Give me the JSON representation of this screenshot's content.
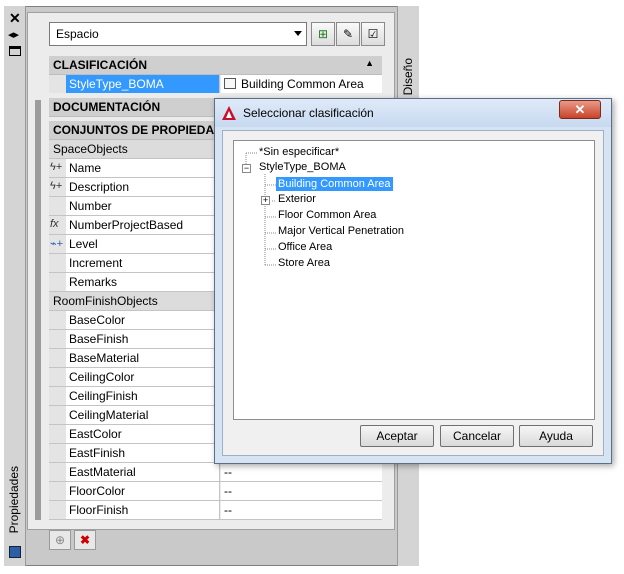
{
  "palette": {
    "left_icons": [
      "close-icon",
      "auto-hide-icon",
      "properties-menu-icon"
    ],
    "vertical_tab_left": "Propiedades",
    "vertical_tab_right": "Diseño",
    "dropdown_value": "Espacio",
    "toolbar_buttons": [
      "select-objects-icon",
      "quick-select-icon",
      "toggle-pickadd-icon"
    ],
    "sections": {
      "clasificacion": "CLASIFICACIÓN",
      "documentacion": "DOCUMENTACIÓN",
      "conjuntos": "CONJUNTOS DE PROPIEDADES"
    },
    "classification_row": {
      "name": "StyleType_BOMA",
      "value": "Building Common Area"
    },
    "groups": {
      "space": "SpaceObjects",
      "room": "RoomFinishObjects"
    },
    "space_rows": [
      {
        "name": "Name",
        "icon": "auto-property-icon"
      },
      {
        "name": "Description",
        "icon": "auto-property-icon"
      },
      {
        "name": "Number",
        "icon": ""
      },
      {
        "name": "NumberProjectBased",
        "icon": "formula-icon"
      },
      {
        "name": "Level",
        "icon": "level-icon"
      },
      {
        "name": "Increment",
        "icon": ""
      },
      {
        "name": "Remarks",
        "icon": ""
      }
    ],
    "room_rows": [
      {
        "name": "BaseColor",
        "value": ""
      },
      {
        "name": "BaseFinish",
        "value": ""
      },
      {
        "name": "BaseMaterial",
        "value": ""
      },
      {
        "name": "CeilingColor",
        "value": ""
      },
      {
        "name": "CeilingFinish",
        "value": ""
      },
      {
        "name": "CeilingMaterial",
        "value": ""
      },
      {
        "name": "EastColor",
        "value": ""
      },
      {
        "name": "EastFinish",
        "value": ""
      },
      {
        "name": "EastMaterial",
        "value": "--"
      },
      {
        "name": "FloorColor",
        "value": "--"
      },
      {
        "name": "FloorFinish",
        "value": "--"
      }
    ],
    "bottom_buttons": [
      "add-property-set-icon",
      "remove-property-set-icon"
    ]
  },
  "dialog": {
    "title": "Seleccionar clasificación",
    "tree": {
      "unspecified": "*Sin especificar*",
      "root": "StyleType_BOMA",
      "children": [
        {
          "label": "Building Common Area",
          "selected": true,
          "expandable": false
        },
        {
          "label": "Exterior",
          "selected": false,
          "expandable": true
        },
        {
          "label": "Floor Common Area",
          "selected": false,
          "expandable": false
        },
        {
          "label": "Major Vertical Penetration",
          "selected": false,
          "expandable": false
        },
        {
          "label": "Office Area",
          "selected": false,
          "expandable": false
        },
        {
          "label": "Store Area",
          "selected": false,
          "expandable": false
        }
      ]
    },
    "buttons": {
      "ok": "Aceptar",
      "cancel": "Cancelar",
      "help": "Ayuda"
    }
  },
  "colors": {
    "selection": "#3399ff",
    "dialog_frame": "#c7d9f0",
    "close_button": "#c8432a"
  }
}
